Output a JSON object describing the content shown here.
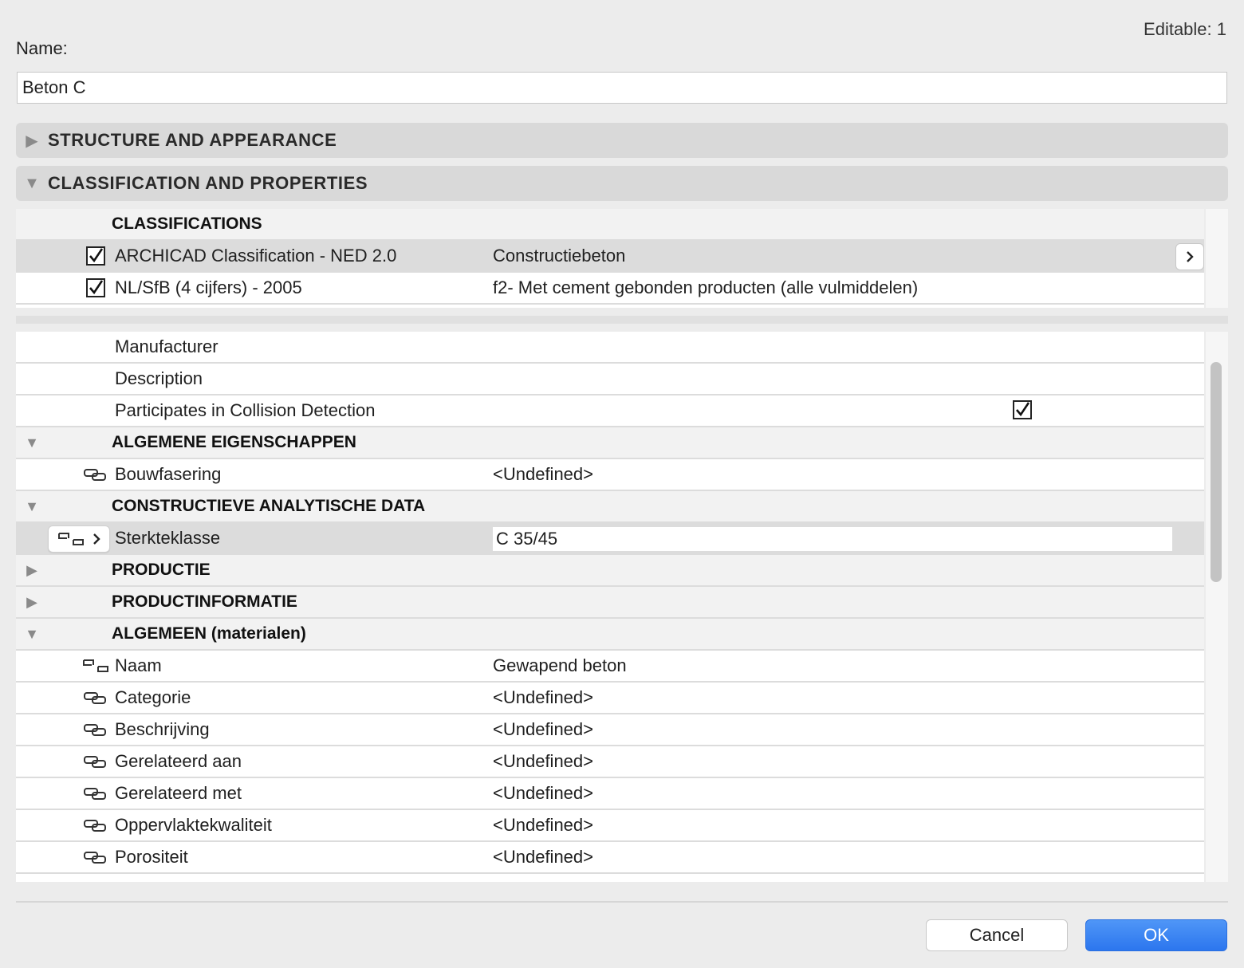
{
  "header": {
    "editable_label": "Editable: 1"
  },
  "name_field": {
    "label": "Name:",
    "value": "Beton C"
  },
  "sections": {
    "structure": "STRUCTURE AND APPEARANCE",
    "classification": "CLASSIFICATION AND PROPERTIES"
  },
  "classifications": {
    "title": "CLASSIFICATIONS",
    "rows": [
      {
        "name": "ARCHICAD Classification - NED 2.0",
        "value": "Constructiebeton"
      },
      {
        "name": "NL/SfB (4 cijfers) - 2005",
        "value": "f2- Met cement gebonden producten (alle vulmiddelen)"
      }
    ]
  },
  "properties": {
    "basic": [
      {
        "name": "Manufacturer"
      },
      {
        "name": "Description"
      },
      {
        "name": "Participates in Collision Detection"
      }
    ],
    "groups": {
      "algemene": "ALGEMENE EIGENSCHAPPEN",
      "constructieve": "CONSTRUCTIEVE ANALYTISCHE DATA",
      "productie": "PRODUCTIE",
      "productinformatie": "PRODUCTINFORMATIE",
      "algemeen": "ALGEMEEN (materialen)"
    },
    "bouwfasering": {
      "name": "Bouwfasering",
      "value": "<Undefined>"
    },
    "sterkteklasse": {
      "name": "Sterkteklasse",
      "value": "C 35/45"
    },
    "algemeen_rows": [
      {
        "name": "Naam",
        "value": "Gewapend beton"
      },
      {
        "name": "Categorie",
        "value": "<Undefined>"
      },
      {
        "name": "Beschrijving",
        "value": "<Undefined>"
      },
      {
        "name": "Gerelateerd aan",
        "value": "<Undefined>"
      },
      {
        "name": "Gerelateerd met",
        "value": "<Undefined>"
      },
      {
        "name": "Oppervlaktekwaliteit",
        "value": "<Undefined>"
      },
      {
        "name": "Porositeit",
        "value": "<Undefined>"
      }
    ]
  },
  "footer": {
    "cancel_label": "Cancel",
    "ok_label": "OK"
  },
  "colors": {
    "accent": "#2c76ee",
    "section_bg": "#d9d9d9",
    "selected_row": "#dcdcdc"
  }
}
